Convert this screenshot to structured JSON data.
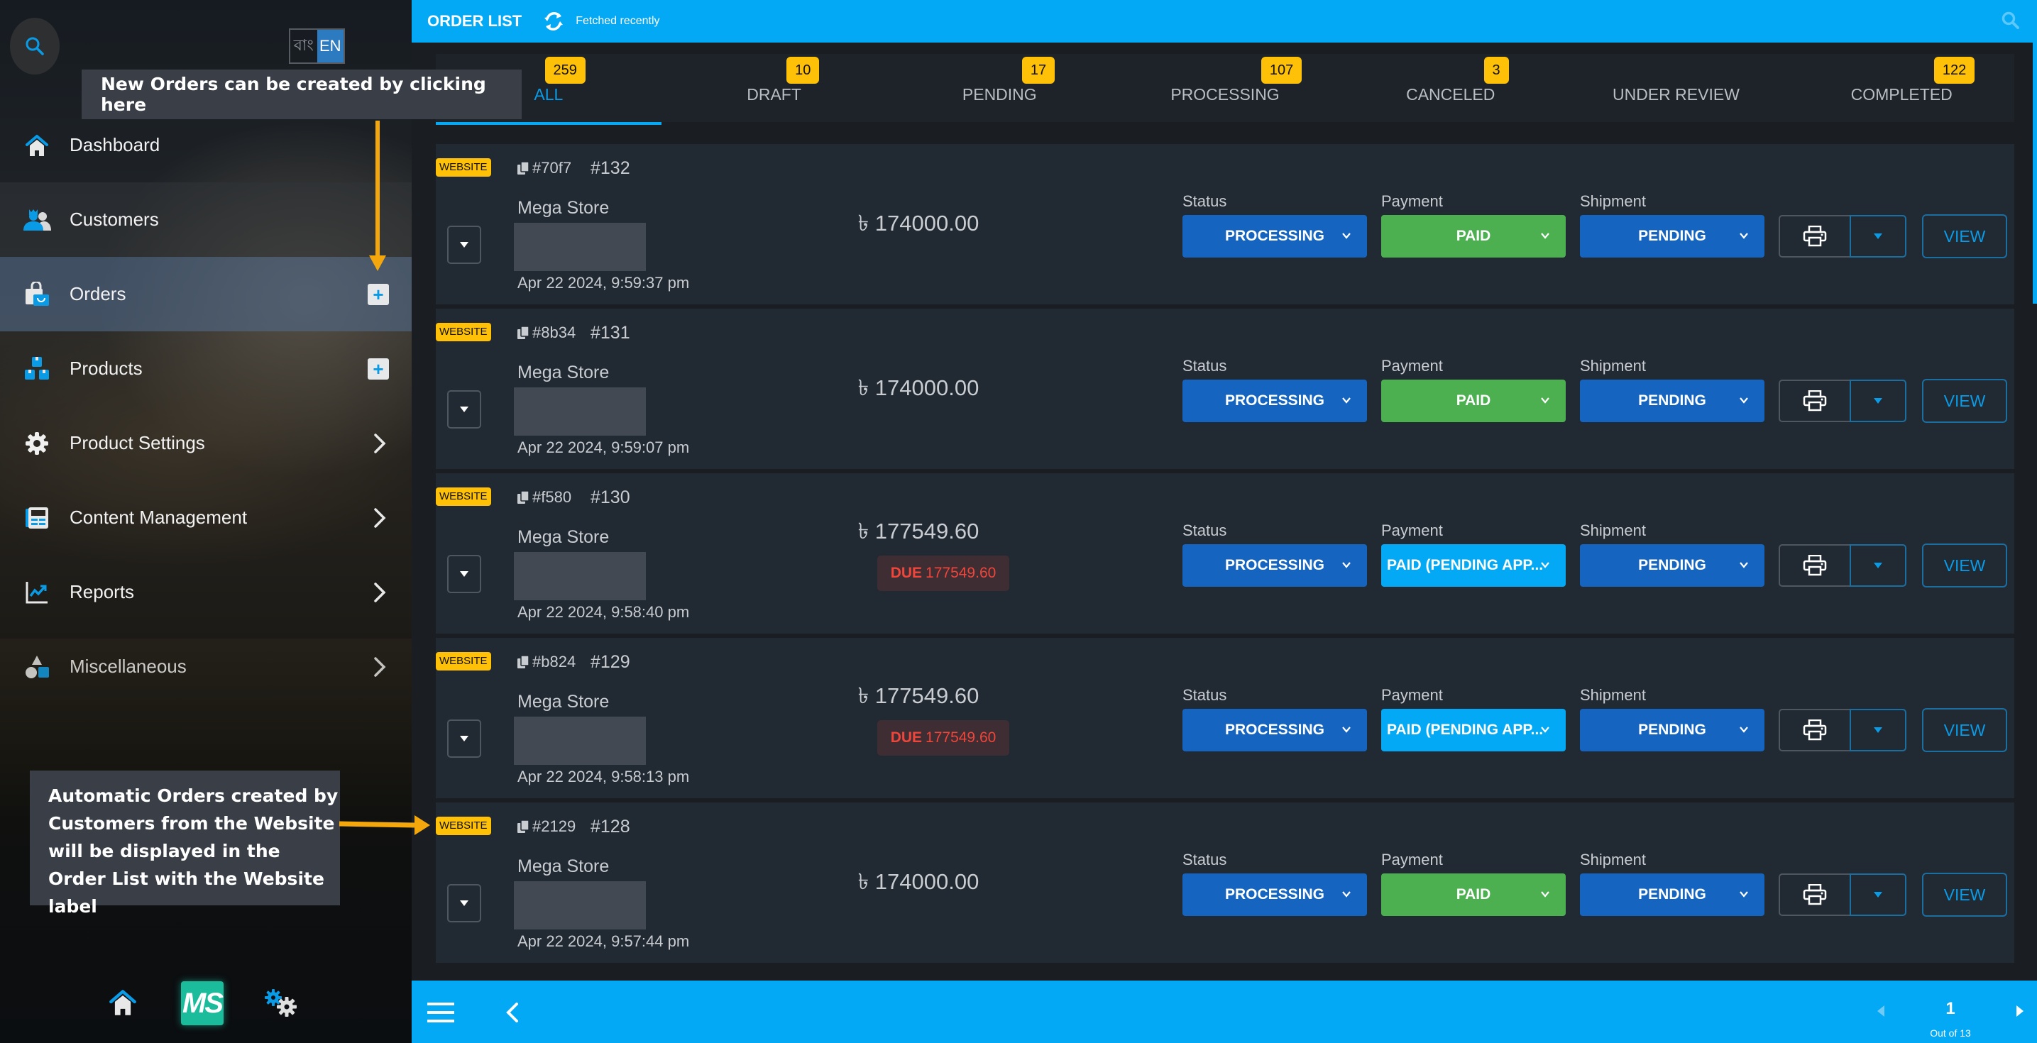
{
  "sidebar": {
    "language": {
      "bn_label": "বাং",
      "en_label": "EN",
      "active": "EN"
    },
    "items": [
      {
        "label": "Dashboard",
        "icon": "home-icon",
        "action": "none"
      },
      {
        "label": "Customers",
        "icon": "customers-icon",
        "action": "none"
      },
      {
        "label": "Orders",
        "icon": "orders-icon",
        "action": "add",
        "active": true
      },
      {
        "label": "Products",
        "icon": "products-icon",
        "action": "add"
      },
      {
        "label": "Product Settings",
        "icon": "gear-icon",
        "action": "expand"
      },
      {
        "label": "Content Management",
        "icon": "content-icon",
        "action": "expand"
      },
      {
        "label": "Reports",
        "icon": "reports-icon",
        "action": "expand"
      },
      {
        "label": "Miscellaneous",
        "icon": "shapes-icon",
        "action": "expand"
      }
    ],
    "bottom": {
      "home": "home-icon",
      "logo_text": "MS",
      "settings": "settings-icon"
    }
  },
  "annotations": {
    "top": "New Orders can be created by clicking here",
    "bottom": "Automatic Orders created by Customers from the Website will be displayed in the Order List with the Website label"
  },
  "header": {
    "title": "ORDER LIST",
    "fetch_status": "Fetched recently"
  },
  "tabs": [
    {
      "label": "ALL",
      "count": "259",
      "active": true
    },
    {
      "label": "DRAFT",
      "count": "10"
    },
    {
      "label": "PENDING",
      "count": "17"
    },
    {
      "label": "PROCESSING",
      "count": "107"
    },
    {
      "label": "CANCELED",
      "count": "3"
    },
    {
      "label": "UNDER REVIEW",
      "count": null
    },
    {
      "label": "COMPLETED",
      "count": "122"
    }
  ],
  "labels": {
    "status": "Status",
    "payment": "Payment",
    "shipment": "Shipment",
    "view": "VIEW",
    "due": "DUE",
    "currency": "৳"
  },
  "orders": [
    {
      "source": "WEBSITE",
      "hash": "#70f7",
      "number": "#132",
      "store": "Mega Store",
      "date": "Apr 22 2024, 9:59:37 pm",
      "amount": "174000.00",
      "due": null,
      "status": "PROCESSING",
      "payment": "PAID",
      "payment_style": "green",
      "shipment": "PENDING"
    },
    {
      "source": "WEBSITE",
      "hash": "#8b34",
      "number": "#131",
      "store": "Mega Store",
      "date": "Apr 22 2024, 9:59:07 pm",
      "amount": "174000.00",
      "due": null,
      "status": "PROCESSING",
      "payment": "PAID",
      "payment_style": "green",
      "shipment": "PENDING"
    },
    {
      "source": "WEBSITE",
      "hash": "#f580",
      "number": "#130",
      "store": "Mega Store",
      "date": "Apr 22 2024, 9:58:40 pm",
      "amount": "177549.60",
      "due": "177549.60",
      "status": "PROCESSING",
      "payment": "PAID (PENDING APP...",
      "payment_style": "light",
      "shipment": "PENDING"
    },
    {
      "source": "WEBSITE",
      "hash": "#b824",
      "number": "#129",
      "store": "Mega Store",
      "date": "Apr 22 2024, 9:58:13 pm",
      "amount": "177549.60",
      "due": "177549.60",
      "status": "PROCESSING",
      "payment": "PAID (PENDING APP...",
      "payment_style": "light",
      "shipment": "PENDING"
    },
    {
      "source": "WEBSITE",
      "hash": "#2129",
      "number": "#128",
      "store": "Mega Store",
      "date": "Apr 22 2024, 9:57:44 pm",
      "amount": "174000.00",
      "due": null,
      "status": "PROCESSING",
      "payment": "PAID",
      "payment_style": "green",
      "shipment": "PENDING"
    }
  ],
  "pagination": {
    "current": "1",
    "total_label": "Out of 13"
  },
  "colors": {
    "primary": "#03a9f4",
    "status_blue": "#1565c0",
    "paid_green": "#4caf50",
    "badge_yellow": "#ffc107",
    "due_red": "#f0453a",
    "annotation_arrow": "#f4a70d"
  }
}
